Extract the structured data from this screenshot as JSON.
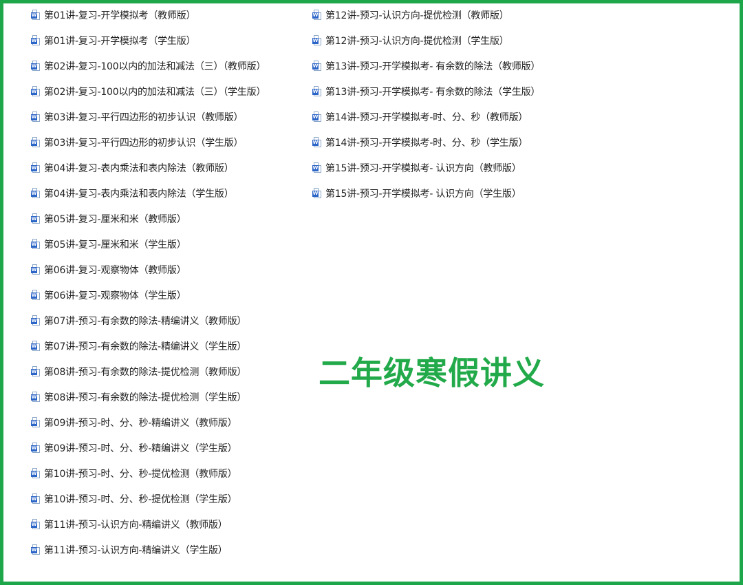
{
  "overlay_title": "二年级寒假讲义",
  "file_icon": "word-document-icon",
  "file_icon_badge": "W",
  "colors": {
    "frame_border": "#1ea64a",
    "overlay_title": "#22aa4a",
    "icon_badge": "#2b65c7"
  },
  "files_left": [
    "第01讲-复习-开学模拟考（教师版）",
    "第01讲-复习-开学模拟考（学生版）",
    "第02讲-复习-100以内的加法和减法（三）（教师版）",
    "第02讲-复习-100以内的加法和减法（三）（学生版）",
    "第03讲-复习-平行四边形的初步认识（教师版）",
    "第03讲-复习-平行四边形的初步认识（学生版）",
    "第04讲-复习-表内乘法和表内除法（教师版）",
    "第04讲-复习-表内乘法和表内除法（学生版）",
    "第05讲-复习-厘米和米（教师版）",
    "第05讲-复习-厘米和米（学生版）",
    "第06讲-复习-观察物体（教师版）",
    "第06讲-复习-观察物体（学生版）",
    "第07讲-预习-有余数的除法-精编讲义（教师版）",
    "第07讲-预习-有余数的除法-精编讲义（学生版）",
    "第08讲-预习-有余数的除法-提优检测（教师版）",
    "第08讲-预习-有余数的除法-提优检测（学生版）",
    "第09讲-预习-时、分、秒-精编讲义（教师版）",
    "第09讲-预习-时、分、秒-精编讲义（学生版）",
    "第10讲-预习-时、分、秒-提优检测（教师版）",
    "第10讲-预习-时、分、秒-提优检测（学生版）",
    "第11讲-预习-认识方向-精编讲义（教师版）",
    "第11讲-预习-认识方向-精编讲义（学生版）"
  ],
  "files_right": [
    "第12讲-预习-认识方向-提优检测（教师版）",
    "第12讲-预习-认识方向-提优检测（学生版）",
    "第13讲-预习-开学模拟考- 有余数的除法（教师版）",
    "第13讲-预习-开学模拟考- 有余数的除法（学生版）",
    "第14讲-预习-开学模拟考-时、分、秒（教师版）",
    "第14讲-预习-开学模拟考-时、分、秒（学生版）",
    "第15讲-预习-开学模拟考- 认识方向（教师版）",
    "第15讲-预习-开学模拟考- 认识方向（学生版）"
  ]
}
